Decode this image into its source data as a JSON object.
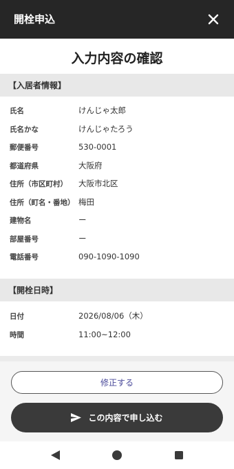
{
  "header": {
    "title": "開栓申込",
    "close_icon": "close-icon"
  },
  "page_title": "入力内容の確認",
  "sections": {
    "resident": {
      "title": "【入居者情報】",
      "rows": [
        {
          "label": "氏名",
          "value": "けんじゃ太郎"
        },
        {
          "label": "氏名かな",
          "value": "けんじゃたろう"
        },
        {
          "label": "郵便番号",
          "value": "530-0001"
        },
        {
          "label": "都道府県",
          "value": "大阪府"
        },
        {
          "label": "住所（市区町村）",
          "value": "大阪市北区"
        },
        {
          "label": "住所（町名・番地）",
          "value": "梅田"
        },
        {
          "label": "建物名",
          "value": "ー"
        },
        {
          "label": "部屋番号",
          "value": "ー"
        },
        {
          "label": "電話番号",
          "value": "090-1090-1090"
        }
      ]
    },
    "schedule": {
      "title": "【開栓日時】",
      "rows": [
        {
          "label": "日付",
          "value": "2026/08/06（木）"
        },
        {
          "label": "時間",
          "value": "11:00~12:00"
        }
      ]
    }
  },
  "actions": {
    "edit_label": "修正する",
    "submit_label": "この内容で申し込む",
    "submit_icon": "send-icon"
  },
  "navbar": {
    "back_icon": "back-icon",
    "home_icon": "home-icon",
    "recents_icon": "recents-icon"
  },
  "colors": {
    "appbar": "#262626",
    "submit_button": "#3a3a3a",
    "edit_text": "#4a4a9a"
  }
}
